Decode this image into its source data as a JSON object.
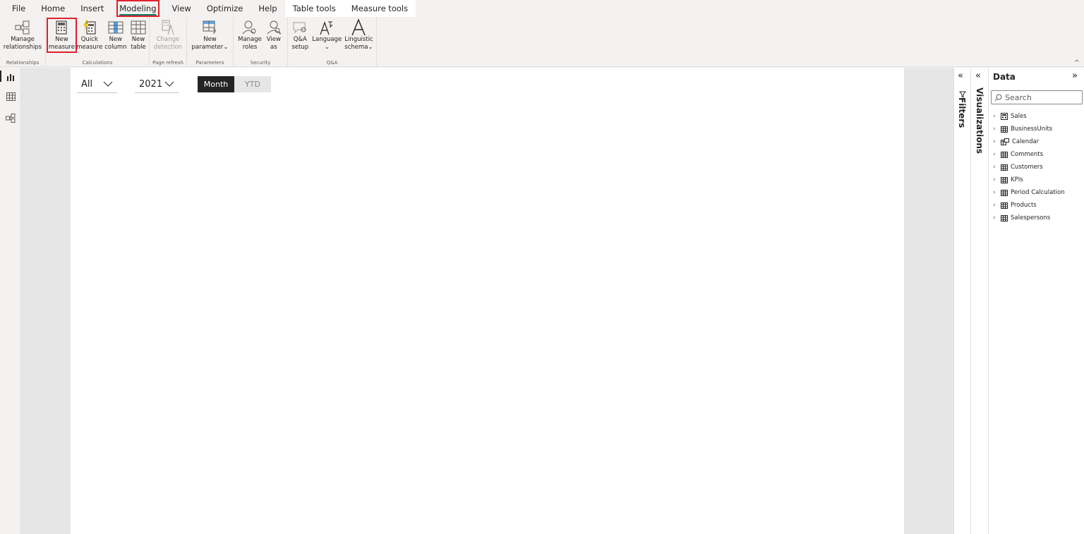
{
  "menu": {
    "tabs": [
      {
        "label": "File"
      },
      {
        "label": "Home"
      },
      {
        "label": "Insert"
      },
      {
        "label": "Modeling"
      },
      {
        "label": "View"
      },
      {
        "label": "Optimize"
      },
      {
        "label": "Help"
      },
      {
        "label": "Table tools"
      },
      {
        "label": "Measure tools"
      }
    ]
  },
  "ribbon": {
    "groups": [
      {
        "label": "Relationships",
        "buttons": [
          {
            "line1": "Manage",
            "line2": "relationships"
          }
        ]
      },
      {
        "label": "Calculations",
        "buttons": [
          {
            "line1": "New",
            "line2": "measure"
          },
          {
            "line1": "Quick",
            "line2": "measure"
          },
          {
            "line1": "New",
            "line2": "column"
          },
          {
            "line1": "New",
            "line2": "table"
          }
        ]
      },
      {
        "label": "Page refresh",
        "buttons": [
          {
            "line1": "Change",
            "line2": "detection"
          }
        ]
      },
      {
        "label": "Parameters",
        "buttons": [
          {
            "line1": "New",
            "line2": "parameter⌄"
          }
        ]
      },
      {
        "label": "Security",
        "buttons": [
          {
            "line1": "Manage",
            "line2": "roles"
          },
          {
            "line1": "View",
            "line2": "as"
          }
        ]
      },
      {
        "label": "Q&A",
        "buttons": [
          {
            "line1": "Q&A",
            "line2": "setup"
          },
          {
            "line1": "Language",
            "line2": "⌄"
          },
          {
            "line1": "Linguistic",
            "line2": "schema⌄"
          }
        ]
      }
    ]
  },
  "canvas": {
    "slicer1": {
      "value": "All"
    },
    "slicer2": {
      "value": "2021"
    },
    "toggle": {
      "on": "Month",
      "off": "YTD"
    }
  },
  "panes": {
    "filters": "Filters",
    "visualizations": "Visualizations",
    "data": {
      "title": "Data",
      "search_placeholder": "Search",
      "tables": [
        "Sales",
        "BusinessUnits",
        "Calendar",
        "Comments",
        "Customers",
        "KPIs",
        "Period Calculation",
        "Products",
        "Salespersons"
      ]
    }
  },
  "colors": {
    "accent": "#117865",
    "highlight": "#e0202a",
    "toggle_on": "#252423"
  }
}
